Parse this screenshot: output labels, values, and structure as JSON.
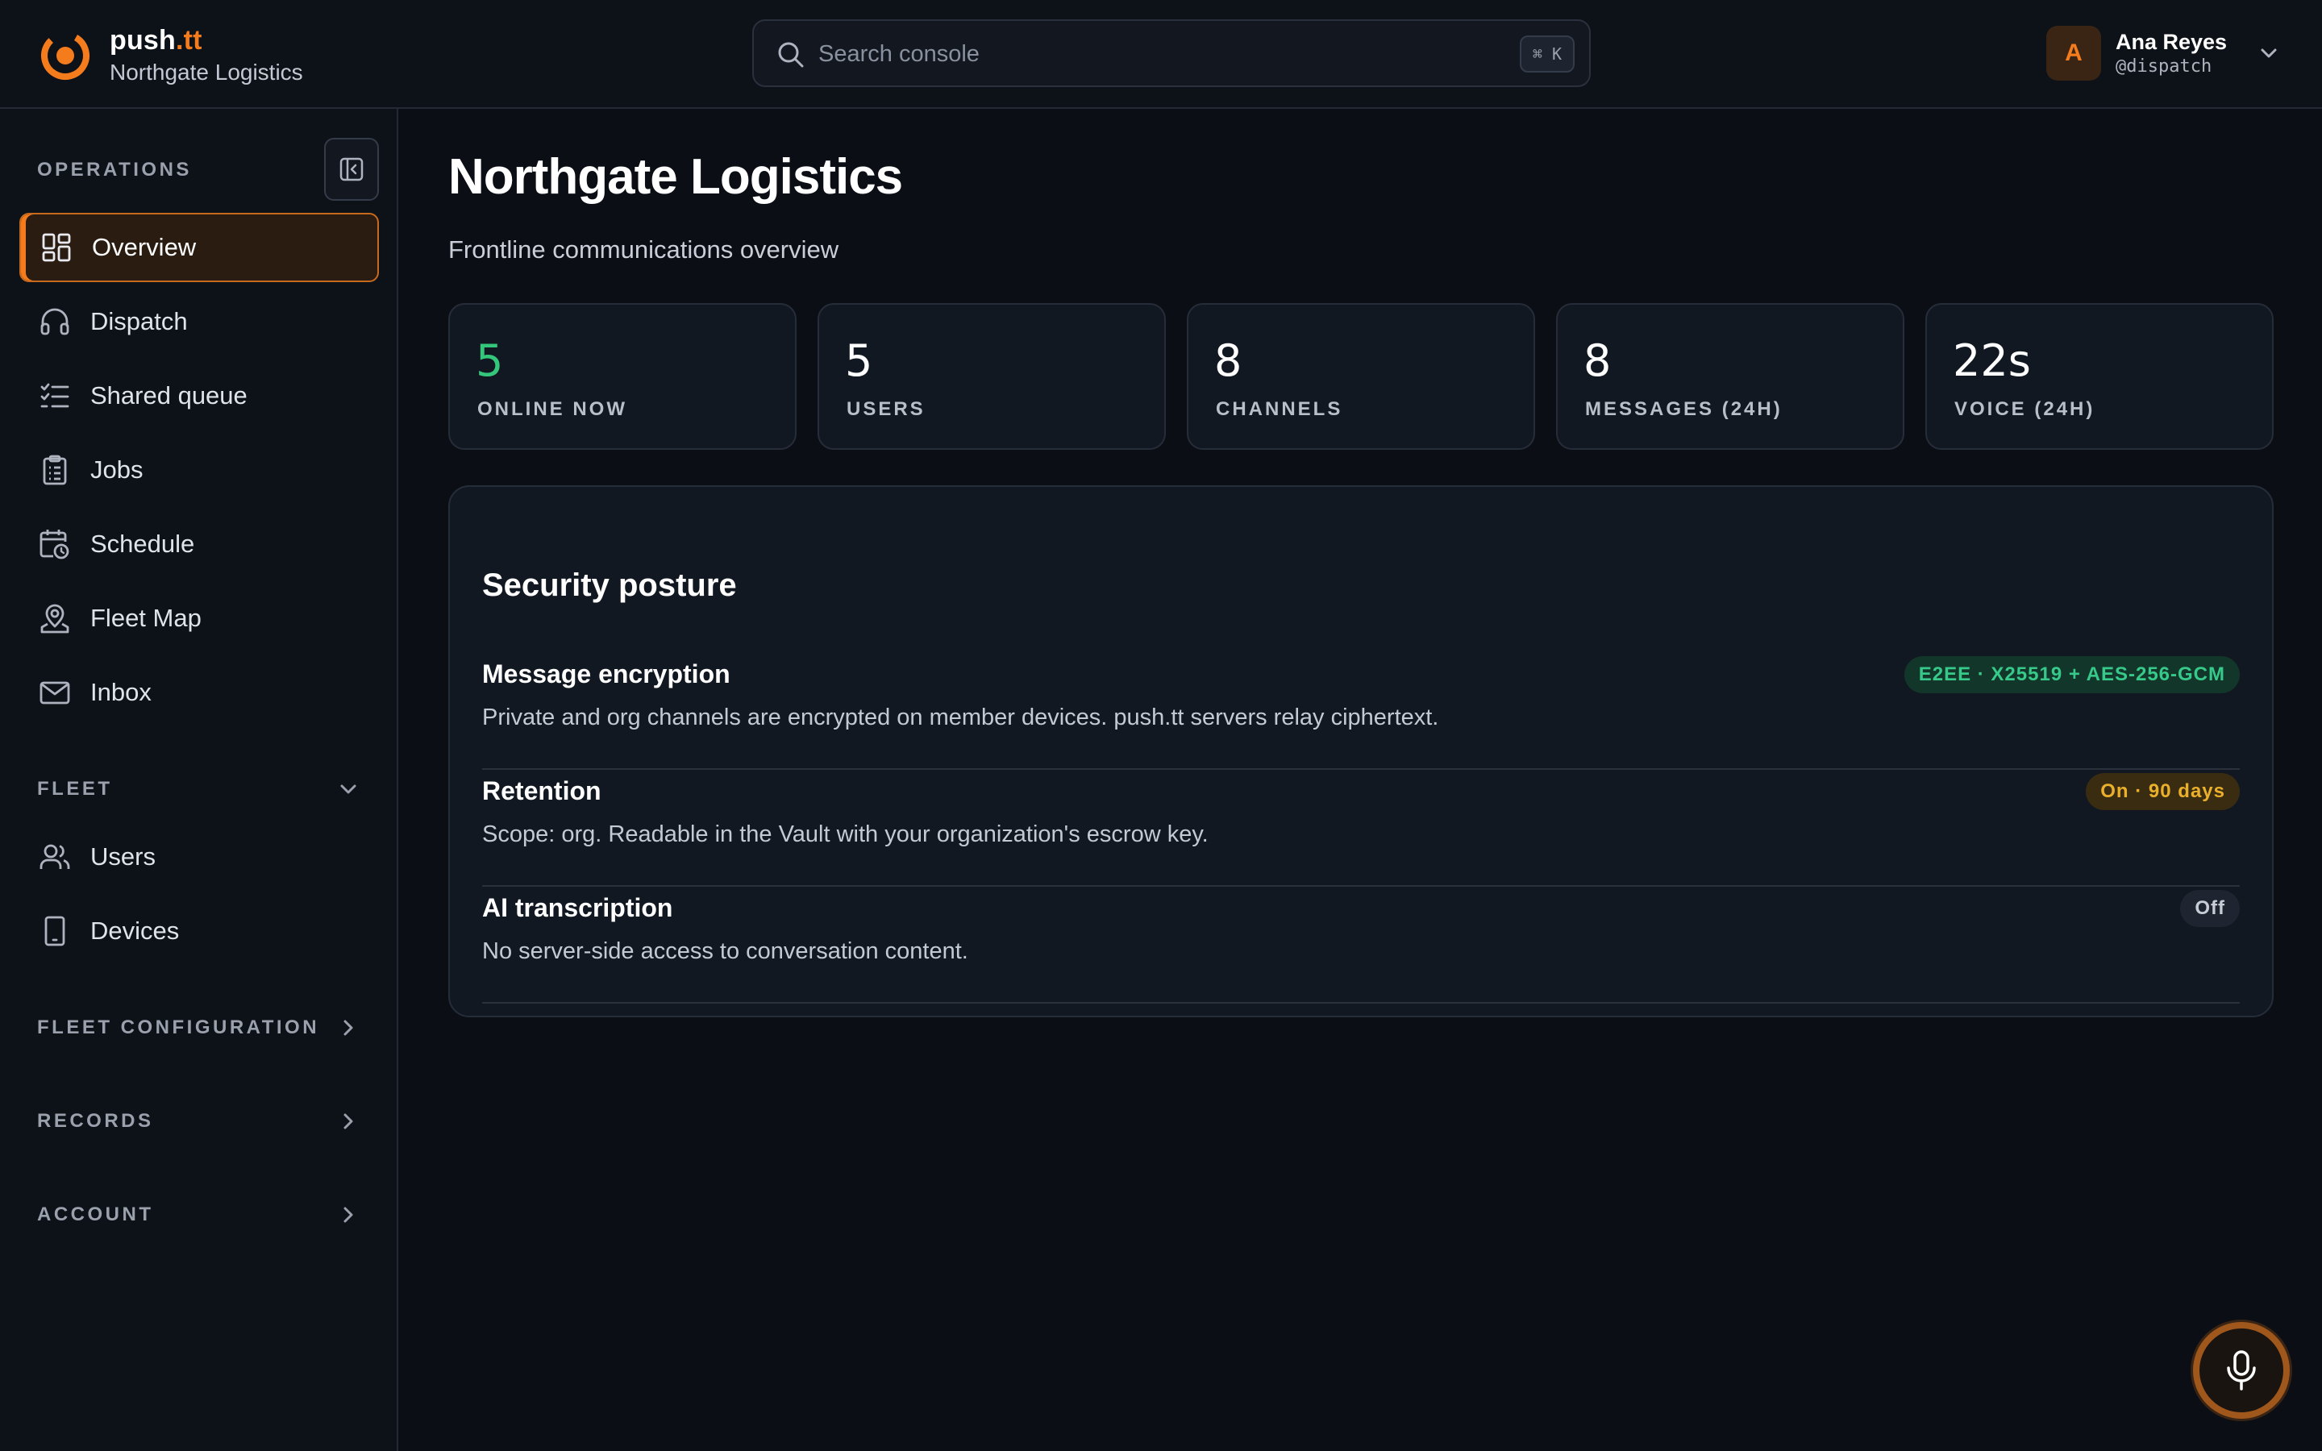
{
  "brand": {
    "name_main": "push",
    "name_accent": ".tt",
    "org": "Northgate Logistics"
  },
  "search": {
    "placeholder": "Search console",
    "shortcut": "⌘ K"
  },
  "user": {
    "initial": "A",
    "name": "Ana Reyes",
    "handle": "@dispatch"
  },
  "sidebar": {
    "operations_label": "OPERATIONS",
    "operations": [
      {
        "label": "Overview",
        "icon": "dashboard-icon",
        "active": true
      },
      {
        "label": "Dispatch",
        "icon": "headset-icon"
      },
      {
        "label": "Shared queue",
        "icon": "checklist-icon"
      },
      {
        "label": "Jobs",
        "icon": "clipboard-icon"
      },
      {
        "label": "Schedule",
        "icon": "calendar-clock-icon"
      },
      {
        "label": "Fleet Map",
        "icon": "map-pin-icon"
      },
      {
        "label": "Inbox",
        "icon": "mail-icon"
      }
    ],
    "fleet_label": "FLEET",
    "fleet": [
      {
        "label": "Users",
        "icon": "users-icon"
      },
      {
        "label": "Devices",
        "icon": "device-icon"
      }
    ],
    "fleet_config_label": "FLEET CONFIGURATION",
    "records_label": "RECORDS",
    "account_label": "ACCOUNT"
  },
  "main": {
    "title": "Northgate Logistics",
    "subtitle": "Frontline communications overview",
    "stats": [
      {
        "value": "5",
        "label": "ONLINE NOW",
        "highlight": "#34c77b"
      },
      {
        "value": "5",
        "label": "USERS"
      },
      {
        "value": "8",
        "label": "CHANNELS"
      },
      {
        "value": "8",
        "label": "MESSAGES (24H)"
      },
      {
        "value": "22s",
        "label": "VOICE (24H)"
      }
    ],
    "security": {
      "title": "Security posture",
      "rows": [
        {
          "title": "Message encryption",
          "description": "Private and org channels are encrypted on member devices. push.tt servers relay ciphertext.",
          "badge": "E2EE · X25519 + AES-256-GCM",
          "badge_color": "#36c98a"
        },
        {
          "title": "Retention",
          "description": "Scope: org. Readable in the Vault with your organization's escrow key.",
          "badge": "On · 90 days",
          "badge_color": "#eab02c"
        },
        {
          "title": "AI transcription",
          "description": "No server-side access to conversation content.",
          "badge": "Off",
          "badge_color": "#c8ccd4"
        }
      ]
    }
  },
  "colors": {
    "accent": "#f47c1c",
    "background": "#0b0e14",
    "panel": "#121822"
  }
}
